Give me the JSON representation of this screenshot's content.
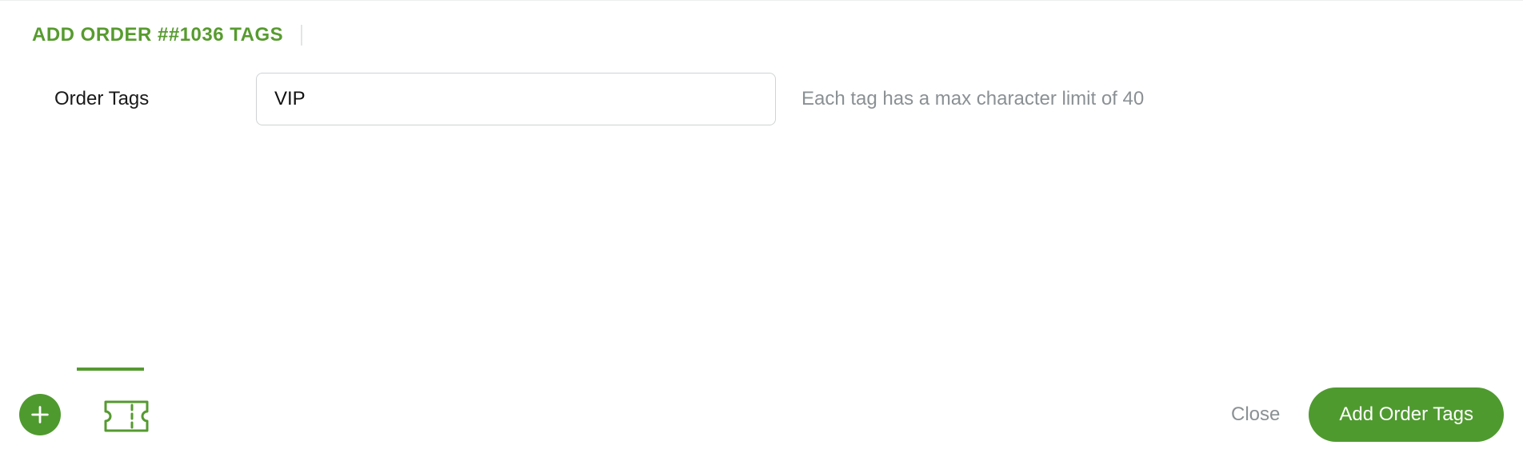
{
  "section": {
    "title": "ADD ORDER ##1036 TAGS"
  },
  "form": {
    "label": "Order Tags",
    "tag_value": "VIP",
    "hint": "Each tag has a max character limit of 40"
  },
  "footer": {
    "close_label": "Close",
    "submit_label": "Add Order Tags"
  }
}
